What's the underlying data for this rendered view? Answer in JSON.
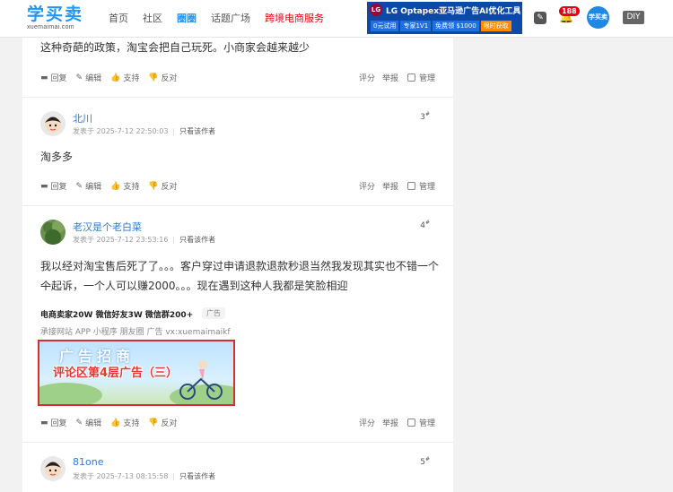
{
  "header": {
    "logo_text": "学买卖",
    "logo_sub": "xuemaimai.com",
    "nav": [
      {
        "label": "首页"
      },
      {
        "label": "社区"
      },
      {
        "label": "圈圈"
      },
      {
        "label": "话题广场"
      },
      {
        "label": "跨境电商服务"
      }
    ],
    "banner": {
      "brand": "LG",
      "title": "LG Optapex亚马逊广告AI优化工具",
      "tags": [
        "0元试用",
        "专家1V1",
        "免费领 $1000",
        "限时获取"
      ]
    },
    "notification_count": "188",
    "avatar_label": "学买卖",
    "diy_label": "DIY"
  },
  "actions": {
    "reply": "回复",
    "edit": "编辑",
    "support": "支持",
    "oppose": "反对",
    "rate": "评分",
    "report": "举报",
    "manage": "管理"
  },
  "posts": [
    {
      "content": "这种奇葩的政策，淘宝会把自己玩死。小商家会越来越少"
    },
    {
      "author": "北川",
      "posted": "发表于 2025-7-12 22:50:03",
      "only_author": "只看该作者",
      "floor": "3",
      "content": "淘多多"
    },
    {
      "author": "老汉是个老白菜",
      "posted": "发表于 2025-7-12 23:53:16",
      "only_author": "只看该作者",
      "floor": "4",
      "content_line1": "我以经对淘宝售后死了了。。。客户穿过申请退款退款秒退当然我发现其实也不错一个一",
      "content_line2": "个起诉，一个人可以赚2000。。。现在遇到这种人我都是笑脸相迎"
    },
    {
      "author": "81one",
      "posted": "发表于 2025-7-13 08:15:58",
      "only_author": "只看该作者",
      "floor": "5"
    }
  ],
  "ad": {
    "title": "电商卖家20W 微信好友3W 微信群200+",
    "tag": "广告",
    "desc": "承接网站 APP 小程序 朋友圈 广告 vx:xuemaimaikf",
    "image_big": "广告招商",
    "image_red": "评论区第4层广告（三）"
  },
  "floor_suffix": "#"
}
